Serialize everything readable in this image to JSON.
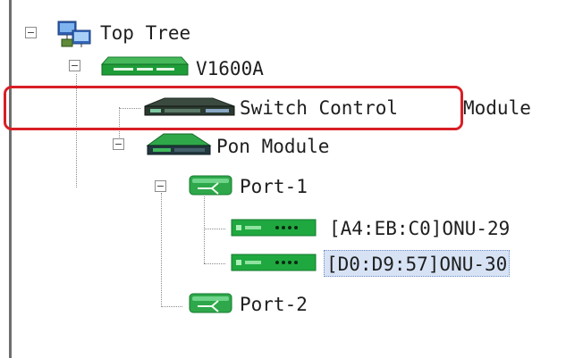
{
  "tree": {
    "root": {
      "label": "Top Tree",
      "toggle": "−",
      "icon": "network-computer-icon"
    },
    "device": {
      "label": "V1600A",
      "toggle": "−",
      "icon": "olt-chassis-icon"
    },
    "switch_module": {
      "label": "Switch Control",
      "label_tail": "Module",
      "icon": "switch-module-icon",
      "highlighted": true
    },
    "pon_module": {
      "label": "Pon Module",
      "toggle": "−",
      "icon": "pon-module-icon"
    },
    "port1": {
      "label": "Port-1",
      "toggle": "−",
      "icon": "port-icon"
    },
    "onus": [
      {
        "label": "[A4:EB:C0]ONU-29",
        "icon": "onu-icon"
      },
      {
        "label": "[D0:D9:57]ONU-30",
        "icon": "onu-icon",
        "selected": true
      }
    ],
    "port2": {
      "label": "Port-2",
      "icon": "port-icon"
    }
  },
  "colors": {
    "highlight": "#d81f26",
    "device_green": "#1e9c37",
    "selection": "#d7e3f5"
  }
}
